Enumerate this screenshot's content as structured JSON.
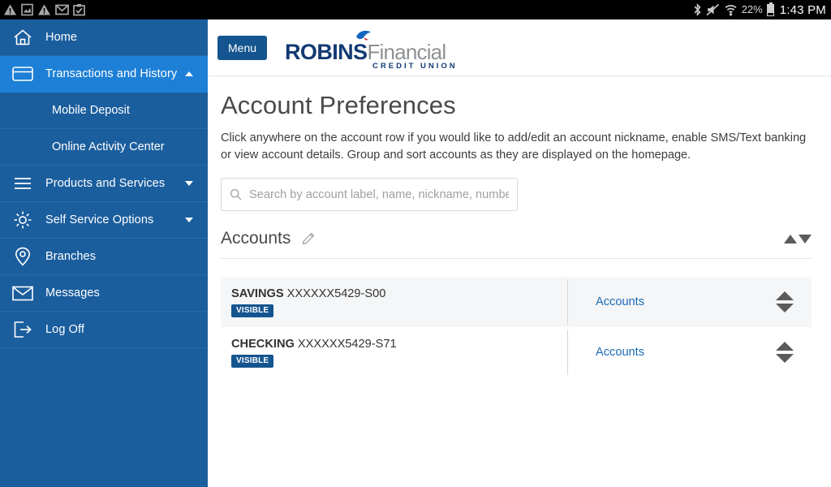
{
  "status_bar": {
    "left_icons": [
      "warning-triangle-icon",
      "photo-icon",
      "warning-triangle-icon",
      "gmail-icon",
      "clipboard-check-icon"
    ],
    "right_icons": [
      "bluetooth-icon",
      "ringer-muted-icon",
      "wifi-icon"
    ],
    "battery_percent": "22%",
    "clock": "1:43 PM"
  },
  "sidebar": {
    "items": [
      {
        "label": "Home",
        "icon": "home-icon",
        "caret": "",
        "active": false
      },
      {
        "label": "Transactions and History",
        "icon": "credit-card-icon",
        "caret": "up",
        "active": true
      },
      {
        "label": "Mobile Deposit",
        "icon": "",
        "caret": "",
        "sub": true
      },
      {
        "label": "Online Activity Center",
        "icon": "",
        "caret": "",
        "sub": true
      },
      {
        "label": "Products and Services",
        "icon": "hamburger-icon",
        "caret": "down",
        "active": false
      },
      {
        "label": "Self Service Options",
        "icon": "gear-icon",
        "caret": "down",
        "active": false
      },
      {
        "label": "Branches",
        "icon": "map-pin-icon",
        "caret": "",
        "active": false
      },
      {
        "label": "Messages",
        "icon": "envelope-icon",
        "caret": "",
        "active": false
      },
      {
        "label": "Log Off",
        "icon": "logout-icon",
        "caret": "",
        "active": false
      }
    ]
  },
  "header": {
    "menu_label": "Menu",
    "logo": {
      "brand_bold": "ROBINS",
      "brand_light": "Financial",
      "tagline": "CREDIT UNION",
      "bird_icon": "bird-icon"
    }
  },
  "page": {
    "title": "Account Preferences",
    "description": "Click anywhere on the account row if you would like to add/edit an account nickname, enable SMS/Text banking or view account details. Group and sort accounts as they are displayed on the homepage."
  },
  "search": {
    "placeholder": "Search by account label, name, nickname, number",
    "value": "",
    "icon": "search-icon"
  },
  "accounts_section": {
    "title": "Accounts",
    "edit_icon": "pencil-icon",
    "sort_up_icon": "triangle-up-icon",
    "sort_down_icon": "triangle-down-icon",
    "rows": [
      {
        "type": "SAVINGS",
        "number": "XXXXXX5429-S00",
        "badge": "VISIBLE",
        "group": "Accounts",
        "shaded": true
      },
      {
        "type": "CHECKING",
        "number": "XXXXXX5429-S71",
        "badge": "VISIBLE",
        "group": "Accounts",
        "shaded": false
      }
    ]
  },
  "colors": {
    "sidebar_blue": "#1b5e9e",
    "sidebar_active_blue": "#1d80d6",
    "menu_button_navy": "#14558f",
    "badge_blue": "#15558f",
    "link_blue": "#1a6bb5",
    "logo_navy": "#123a73",
    "logo_gray": "#8f9194"
  }
}
